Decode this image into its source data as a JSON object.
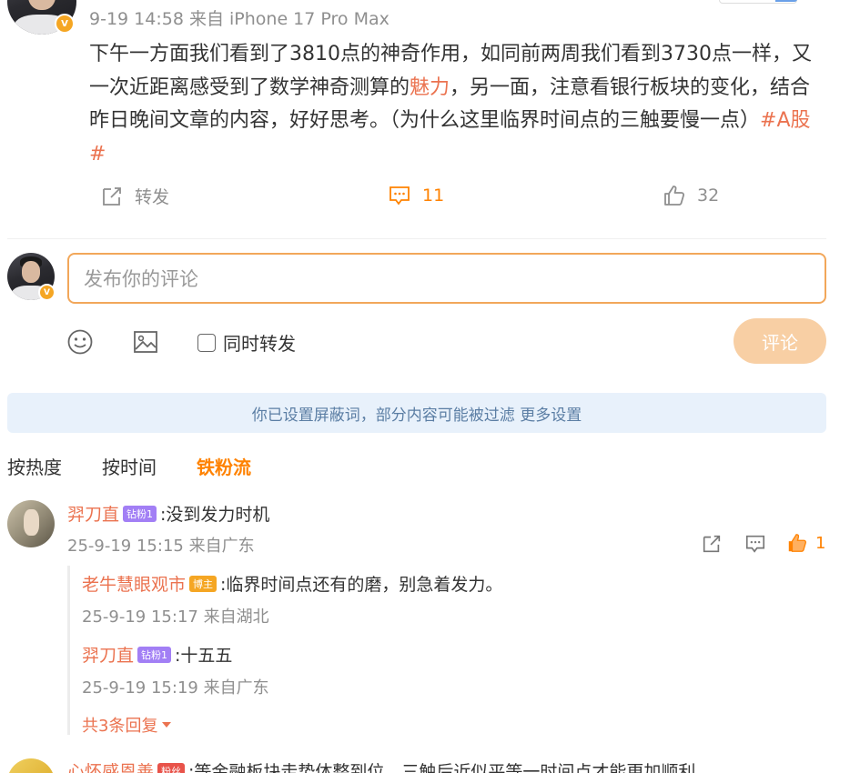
{
  "post": {
    "meta": "9-19 14:58 来自 iPhone 17 Pro Max",
    "text_part1": "下午一方面我们看到了3810点的神奇作用，如同前两周我们看到3730点一样，又一次近距离感受到了数学神奇测算的",
    "text_highlight": "魅力",
    "text_part2": "，另一面，注意看银行板块的变化，结合昨日晚间文章的内容，好好思考。（为什么这里临界时间点的三触要慢一点）",
    "hashtag": "#A股#",
    "actions": {
      "repost_label": "转发",
      "comment_count": "11",
      "like_count": "32"
    }
  },
  "composer": {
    "placeholder": "发布你的评论",
    "also_repost_label": "同时转发",
    "submit_label": "评论"
  },
  "notice": {
    "text": "你已设置屏蔽词，部分内容可能被过滤 更多设置"
  },
  "tabs": [
    {
      "label": "按热度",
      "active": false
    },
    {
      "label": "按时间",
      "active": false
    },
    {
      "label": "铁粉流",
      "active": true
    }
  ],
  "comments": [
    {
      "username": "羿刀直",
      "badge": "钻粉1",
      "text": ":没到发力时机",
      "time": "25-9-19 15:15 来自广东",
      "like_count": "1",
      "replies": [
        {
          "username": "老牛慧眼观市",
          "badge": "博主",
          "text": ":临界时间点还有的磨，别急着发力。",
          "time": "25-9-19 15:17 来自湖北"
        },
        {
          "username": "羿刀直",
          "badge": "钻粉1",
          "text": ":十五五",
          "time": "25-9-19 15:19 来自广东"
        }
      ],
      "more_replies": "共3条回复"
    },
    {
      "username": "心怀感恩善",
      "badge": "粉丝",
      "text": ":等金融板块走势体整到位，三触后近似平等一时间点才能更加顺利"
    }
  ],
  "colors": {
    "accent": "#ff8200",
    "link": "#eb7350",
    "notice_bg": "#e8f1fb",
    "submit_bg": "#f8cfa4"
  }
}
